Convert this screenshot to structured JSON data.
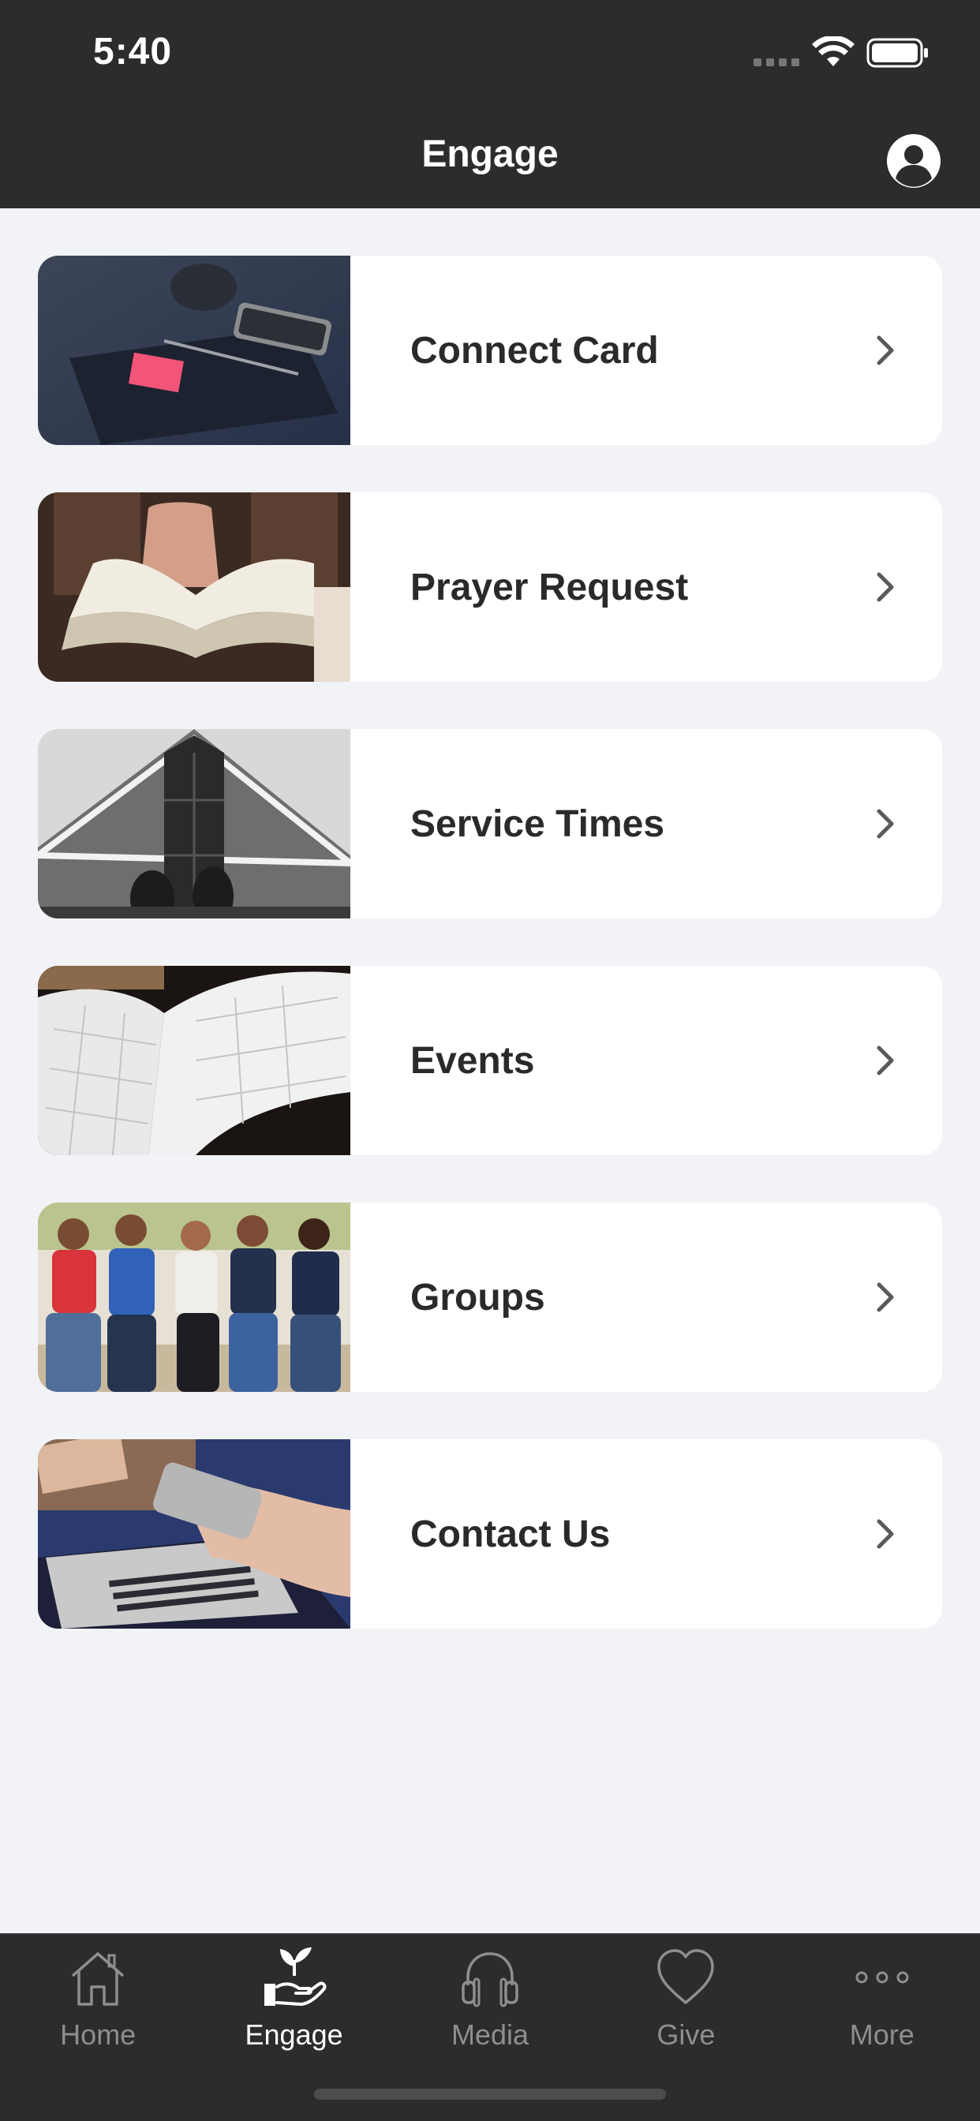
{
  "status_bar": {
    "time": "5:40"
  },
  "header": {
    "title": "Engage"
  },
  "items": [
    {
      "label": "Connect Card",
      "image": "desk-with-notebook-photo"
    },
    {
      "label": "Prayer Request",
      "image": "praying-hands-bible-photo"
    },
    {
      "label": "Service Times",
      "image": "church-building-photo"
    },
    {
      "label": "Events",
      "image": "open-calendar-photo"
    },
    {
      "label": "Groups",
      "image": "group-of-friends-photo"
    },
    {
      "label": "Contact Us",
      "image": "phone-laptop-photo"
    }
  ],
  "tabs": [
    {
      "label": "Home",
      "icon": "home-icon",
      "active": false
    },
    {
      "label": "Engage",
      "icon": "engage-hand-plant-icon",
      "active": true
    },
    {
      "label": "Media",
      "icon": "headphones-icon",
      "active": false
    },
    {
      "label": "Give",
      "icon": "heart-icon",
      "active": false
    },
    {
      "label": "More",
      "icon": "more-dots-icon",
      "active": false
    }
  ],
  "colors": {
    "header_bg": "#2c2c2c",
    "page_bg": "#f2f3f7",
    "card_bg": "#ffffff",
    "tab_active": "#ffffff",
    "tab_inactive": "#8e8e8e"
  }
}
